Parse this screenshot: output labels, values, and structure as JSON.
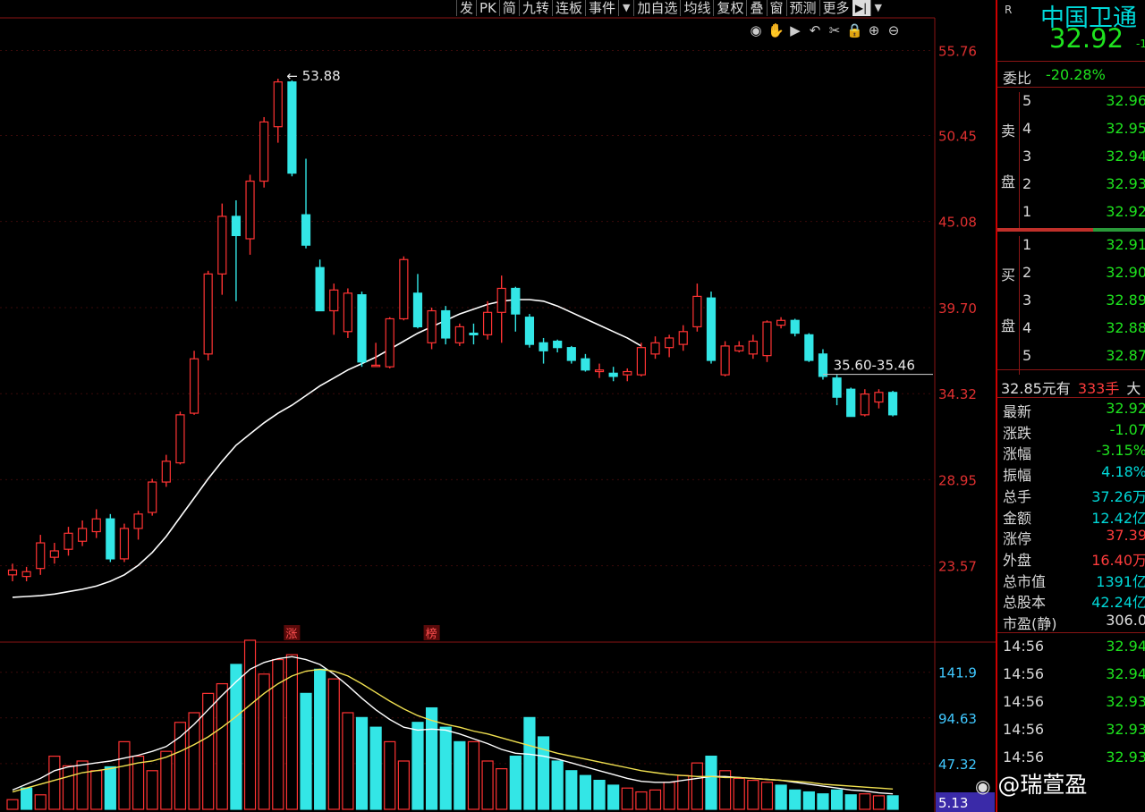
{
  "toolbar": {
    "items": [
      "发",
      "PK",
      "简",
      "九转",
      "连板",
      "事件",
      "▼",
      "加自选",
      "均线",
      "复权",
      "叠",
      "窗",
      "预测",
      "更多"
    ],
    "last_label": "▶|"
  },
  "chart_icons": [
    "eye-icon",
    "hand-icon",
    "play-icon",
    "undo-icon",
    "scissors-icon",
    "lock-icon",
    "zoom-in-icon",
    "zoom-out-icon"
  ],
  "chart_data": [
    {
      "type": "candlestick",
      "price_axis": [
        "55.76",
        "50.45",
        "45.08",
        "39.70",
        "34.32",
        "28.95",
        "23.57"
      ],
      "ylim": [
        18.8,
        57.8
      ],
      "peak_label": "53.88",
      "range_label": "35.60-35.46",
      "markers": [
        "涨",
        "榜"
      ],
      "colors": {
        "up": "#ff3333",
        "down": "#33e6e6",
        "ma": "#ffffff"
      },
      "candles": [
        [
          23.0,
          23.3,
          22.6,
          23.7
        ],
        [
          22.9,
          23.2,
          22.6,
          23.5
        ],
        [
          23.4,
          25.0,
          23.0,
          25.5
        ],
        [
          24.1,
          24.5,
          23.7,
          25.0
        ],
        [
          24.6,
          25.6,
          24.2,
          26.0
        ],
        [
          25.1,
          25.9,
          24.8,
          26.4
        ],
        [
          25.7,
          26.5,
          25.3,
          27.1
        ],
        [
          26.5,
          24.0,
          23.8,
          26.8
        ],
        [
          24.0,
          25.9,
          23.8,
          26.2
        ],
        [
          25.9,
          26.8,
          25.2,
          27.0
        ],
        [
          26.9,
          28.8,
          26.7,
          29.0
        ],
        [
          28.8,
          30.1,
          28.5,
          30.5
        ],
        [
          30.0,
          33.0,
          29.9,
          33.2
        ],
        [
          33.1,
          36.5,
          33.0,
          37.0
        ],
        [
          36.8,
          41.8,
          36.4,
          42.0
        ],
        [
          41.8,
          45.4,
          40.5,
          46.2
        ],
        [
          45.4,
          44.2,
          40.1,
          46.4
        ],
        [
          44.0,
          47.6,
          43.0,
          48.0
        ],
        [
          47.6,
          51.3,
          47.2,
          51.6
        ],
        [
          51.0,
          53.8,
          50.0,
          54.0
        ],
        [
          53.8,
          48.1,
          47.9,
          53.9
        ],
        [
          45.5,
          43.6,
          43.4,
          49.0
        ],
        [
          42.2,
          39.5,
          39.5,
          42.7
        ],
        [
          39.5,
          40.8,
          38.0,
          41.2
        ],
        [
          38.2,
          40.6,
          37.8,
          40.9
        ],
        [
          40.5,
          36.3,
          36.0,
          40.7
        ],
        [
          36.1,
          36.1,
          36.0,
          37.5
        ],
        [
          36.0,
          39.0,
          35.9,
          39.1
        ],
        [
          39.0,
          42.7,
          38.9,
          42.9
        ],
        [
          40.6,
          38.5,
          38.4,
          41.8
        ],
        [
          37.5,
          39.5,
          37.1,
          39.7
        ],
        [
          39.5,
          37.8,
          37.4,
          39.8
        ],
        [
          37.5,
          38.5,
          37.3,
          38.7
        ],
        [
          38.1,
          38.0,
          37.4,
          38.7
        ],
        [
          38.0,
          39.4,
          37.7,
          40.1
        ],
        [
          39.4,
          40.9,
          37.5,
          41.7
        ],
        [
          40.9,
          39.3,
          38.2,
          41.0
        ],
        [
          39.1,
          37.4,
          37.2,
          39.3
        ],
        [
          37.5,
          37.0,
          36.2,
          37.8
        ],
        [
          37.6,
          37.2,
          36.9,
          37.7
        ],
        [
          37.2,
          36.4,
          36.2,
          37.3
        ],
        [
          36.5,
          35.8,
          35.7,
          36.8
        ],
        [
          35.7,
          35.8,
          35.3,
          36.2
        ],
        [
          35.6,
          35.4,
          35.1,
          36.0
        ],
        [
          35.5,
          35.7,
          35.1,
          35.9
        ],
        [
          35.5,
          37.2,
          35.4,
          37.5
        ],
        [
          36.8,
          37.5,
          36.5,
          37.9
        ],
        [
          37.2,
          37.8,
          36.6,
          38.0
        ],
        [
          37.4,
          38.2,
          37.0,
          38.6
        ],
        [
          38.5,
          40.4,
          38.2,
          41.2
        ],
        [
          40.3,
          36.4,
          36.2,
          40.7
        ],
        [
          35.5,
          37.3,
          35.4,
          37.6
        ],
        [
          37.0,
          37.3,
          36.9,
          37.6
        ],
        [
          36.8,
          37.6,
          36.5,
          38.0
        ],
        [
          36.7,
          38.8,
          36.3,
          38.9
        ],
        [
          38.6,
          38.9,
          38.4,
          39.1
        ],
        [
          38.9,
          38.1,
          37.9,
          39.0
        ],
        [
          38.0,
          36.4,
          36.3,
          38.1
        ],
        [
          36.8,
          35.4,
          35.2,
          37.1
        ],
        [
          35.3,
          34.1,
          33.6,
          35.5
        ],
        [
          34.6,
          32.9,
          32.9,
          34.7
        ],
        [
          33.0,
          34.3,
          32.9,
          34.6
        ],
        [
          33.8,
          34.4,
          33.4,
          34.6
        ],
        [
          34.4,
          33.0,
          32.9,
          34.5
        ]
      ],
      "ma": [
        21.6,
        21.65,
        21.7,
        21.8,
        21.95,
        22.1,
        22.3,
        22.6,
        23.0,
        23.6,
        24.4,
        25.4,
        26.6,
        27.8,
        29.0,
        30.1,
        31.1,
        31.8,
        32.5,
        33.1,
        33.6,
        34.2,
        34.8,
        35.3,
        35.8,
        36.2,
        36.6,
        37.1,
        37.6,
        38.1,
        38.5,
        38.9,
        39.3,
        39.6,
        39.9,
        40.1,
        40.2,
        40.2,
        40.1,
        39.8,
        39.4,
        39.0,
        38.6,
        38.2,
        37.8,
        37.3
      ]
    },
    {
      "type": "bar",
      "volume_axis": [
        "141.9",
        "94.63",
        "47.32",
        "5.13"
      ],
      "ylim": [
        0,
        162
      ],
      "values": [
        10,
        22,
        15,
        55,
        45,
        50,
        40,
        44,
        70,
        55,
        40,
        60,
        90,
        100,
        120,
        130,
        150,
        175,
        140,
        155,
        160,
        120,
        145,
        135,
        100,
        95,
        85,
        70,
        50,
        90,
        105,
        85,
        70,
        70,
        50,
        42,
        55,
        95,
        75,
        50,
        40,
        35,
        30,
        25,
        22,
        18,
        20,
        28,
        35,
        48,
        55,
        40,
        32,
        30,
        28,
        25,
        20,
        18,
        16,
        20,
        15,
        16,
        14,
        14
      ],
      "up": [
        true,
        false,
        true,
        true,
        true,
        true,
        true,
        false,
        true,
        true,
        true,
        true,
        true,
        true,
        true,
        true,
        false,
        true,
        true,
        true,
        true,
        false,
        false,
        true,
        true,
        false,
        false,
        true,
        true,
        false,
        false,
        false,
        false,
        true,
        true,
        true,
        false,
        false,
        false,
        false,
        false,
        false,
        false,
        false,
        true,
        true,
        true,
        true,
        true,
        true,
        false,
        true,
        true,
        true,
        true,
        false,
        false,
        false,
        false,
        false,
        false,
        true,
        true,
        false
      ],
      "ma_white": [
        20,
        26,
        32,
        40,
        44,
        46,
        48,
        50,
        53,
        56,
        60,
        65,
        75,
        88,
        103,
        118,
        132,
        145,
        152,
        156,
        158,
        155,
        150,
        140,
        128,
        115,
        103,
        93,
        85,
        82,
        83,
        82,
        78,
        73,
        68,
        62,
        58,
        57,
        55,
        52,
        48,
        44,
        40,
        36,
        32,
        29,
        28,
        28,
        30,
        32,
        34,
        34,
        33,
        32,
        31,
        30,
        28,
        26,
        24,
        22,
        20,
        19,
        17,
        16
      ],
      "ma_yellow": [
        18,
        22,
        26,
        30,
        34,
        38,
        40,
        42,
        45,
        48,
        50,
        54,
        60,
        67,
        75,
        85,
        96,
        108,
        120,
        130,
        138,
        143,
        145,
        143,
        138,
        130,
        121,
        112,
        104,
        97,
        92,
        88,
        85,
        81,
        78,
        74,
        70,
        66,
        62,
        58,
        55,
        52,
        49,
        46,
        43,
        40,
        38,
        36,
        35,
        34,
        34,
        33,
        33,
        32,
        31,
        30,
        29,
        28,
        26,
        25,
        24,
        23,
        22,
        21
      ],
      "colors": {
        "up": "#ff3333",
        "down": "#33e6e6",
        "ma_white": "#ffffff",
        "ma_yellow": "#f0e050"
      }
    }
  ],
  "quote": {
    "code_marker": "R",
    "name": "中国卫通",
    "price": "32.92",
    "change_short": "-1",
    "commission_ratio_label": "委比",
    "commission_ratio": "-20.28%",
    "sell_label": [
      "卖",
      "盘"
    ],
    "buy_label": [
      "买",
      "盘"
    ],
    "sells": [
      {
        "level": "5",
        "price": "32.96"
      },
      {
        "level": "4",
        "price": "32.95"
      },
      {
        "level": "3",
        "price": "32.94"
      },
      {
        "level": "2",
        "price": "32.93"
      },
      {
        "level": "1",
        "price": "32.92"
      }
    ],
    "buys": [
      {
        "level": "1",
        "price": "32.91"
      },
      {
        "level": "2",
        "price": "32.90"
      },
      {
        "level": "3",
        "price": "32.89"
      },
      {
        "level": "4",
        "price": "32.88"
      },
      {
        "level": "5",
        "price": "32.87"
      }
    ],
    "trade_line": {
      "price": "32.85元有",
      "qty": "333手",
      "tag": "大"
    },
    "stats": [
      {
        "label": "最新",
        "value": "32.92",
        "color": "green"
      },
      {
        "label": "涨跌",
        "value": "-1.07",
        "color": "green"
      },
      {
        "label": "涨幅",
        "value": "-3.15%",
        "color": "green"
      },
      {
        "label": "振幅",
        "value": "4.18%",
        "color": "cyan"
      },
      {
        "label": "总手",
        "value": "37.26万",
        "color": "cyan"
      },
      {
        "label": "金额",
        "value": "12.42亿",
        "color": "cyan"
      },
      {
        "label": "涨停",
        "value": "37.39",
        "color": "red"
      },
      {
        "label": "外盘",
        "value": "16.40万",
        "color": "red"
      },
      {
        "label": "总市值",
        "value": "1391亿",
        "color": "cyan"
      },
      {
        "label": "总股本",
        "value": "42.24亿",
        "color": "cyan"
      },
      {
        "label": "市盈(静)",
        "value": "306.0",
        "color": "white"
      }
    ],
    "ticks": [
      {
        "time": "14:56",
        "price": "32.94"
      },
      {
        "time": "14:56",
        "price": "32.94"
      },
      {
        "time": "14:56",
        "price": "32.93"
      },
      {
        "time": "14:56",
        "price": "32.93"
      },
      {
        "time": "14:56",
        "price": "32.93"
      }
    ]
  },
  "watermark": "@瑞萱盈"
}
